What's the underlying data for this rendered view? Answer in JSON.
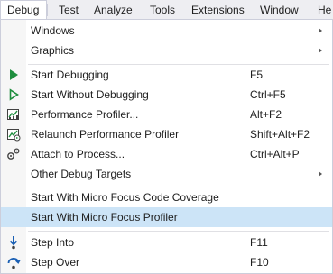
{
  "menubar": {
    "items": [
      "Debug",
      "Test",
      "Analyze",
      "Tools",
      "Extensions",
      "Window",
      "He"
    ]
  },
  "menu": {
    "items": [
      {
        "label": "Windows",
        "shortcut": "",
        "submenu": true,
        "icon": ""
      },
      {
        "label": "Graphics",
        "shortcut": "",
        "submenu": true,
        "icon": ""
      },
      {
        "label": "Start Debugging",
        "shortcut": "F5",
        "submenu": false,
        "icon": "play-solid-icon"
      },
      {
        "label": "Start Without Debugging",
        "shortcut": "Ctrl+F5",
        "submenu": false,
        "icon": "play-outline-icon"
      },
      {
        "label": "Performance Profiler...",
        "shortcut": "Alt+F2",
        "submenu": false,
        "icon": "performance-profiler-icon"
      },
      {
        "label": "Relaunch Performance Profiler",
        "shortcut": "Shift+Alt+F2",
        "submenu": false,
        "icon": "relaunch-profiler-icon"
      },
      {
        "label": "Attach to Process...",
        "shortcut": "Ctrl+Alt+P",
        "submenu": false,
        "icon": "attach-process-icon"
      },
      {
        "label": "Other Debug Targets",
        "shortcut": "",
        "submenu": true,
        "icon": ""
      },
      {
        "label": "Start With Micro Focus Code Coverage",
        "shortcut": "",
        "submenu": false,
        "icon": ""
      },
      {
        "label": "Start With Micro Focus Profiler",
        "shortcut": "",
        "submenu": false,
        "icon": "",
        "highlighted": true
      },
      {
        "label": "Step Into",
        "shortcut": "F11",
        "submenu": false,
        "icon": "step-into-icon"
      },
      {
        "label": "Step Over",
        "shortcut": "F10",
        "submenu": false,
        "icon": "step-over-icon"
      }
    ]
  },
  "colors": {
    "accent_green": "#1e8e3e",
    "highlight": "#cce4f7",
    "step_blue": "#1a5fb4"
  }
}
